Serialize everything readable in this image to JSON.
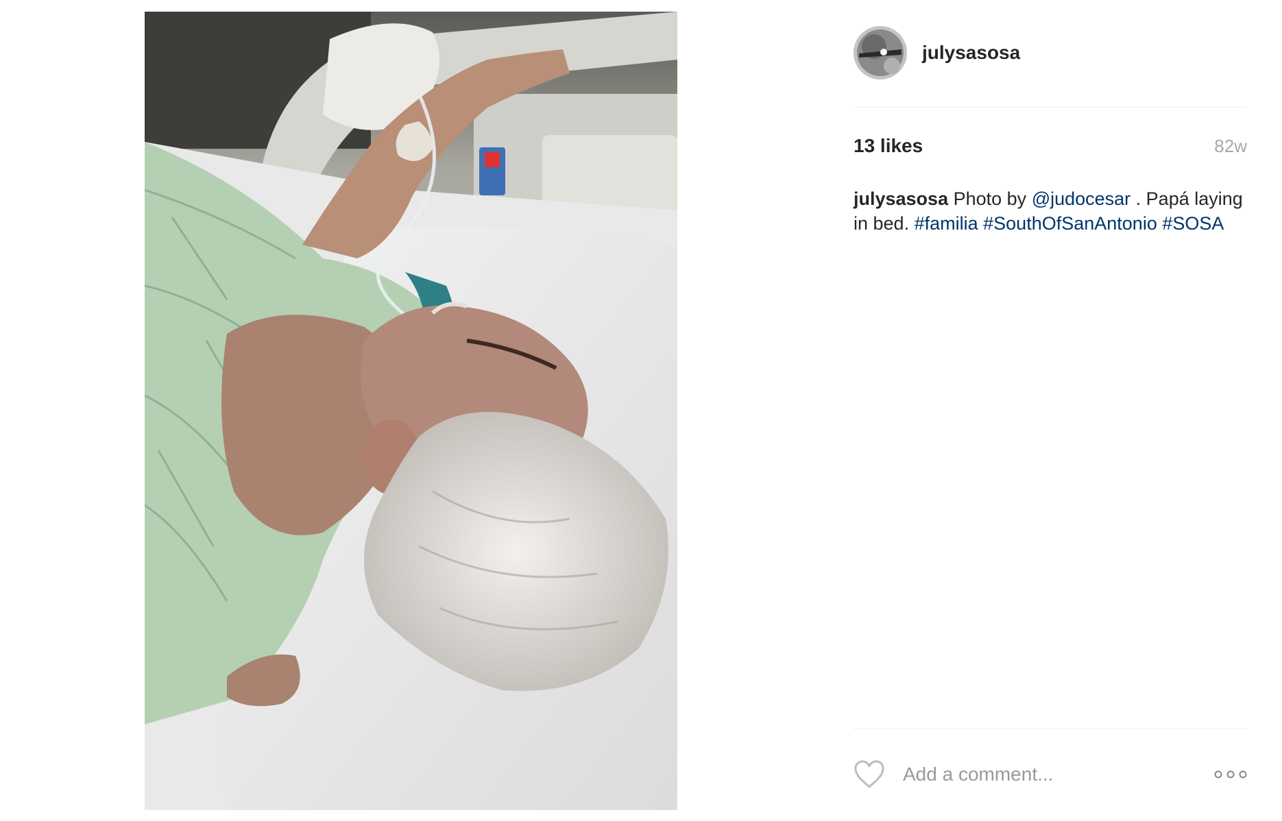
{
  "post": {
    "username": "julysasosa",
    "likes": "13 likes",
    "time_ago": "82w",
    "caption": {
      "user": "julysasosa",
      "part1": " Photo by ",
      "mention": "@judocesar",
      "part2": " . Papá laying in bed. ",
      "tag1": "#familia",
      "tag2": "#SouthOfSanAntonio",
      "tag3": "#SOSA"
    },
    "comment_placeholder": "Add a comment..."
  },
  "icons": {
    "like": "heart-outline-icon",
    "more": "more-options-icon"
  },
  "colors": {
    "text": "#262626",
    "link": "#003569",
    "muted": "#a5a7aa",
    "divider": "#efefef"
  }
}
